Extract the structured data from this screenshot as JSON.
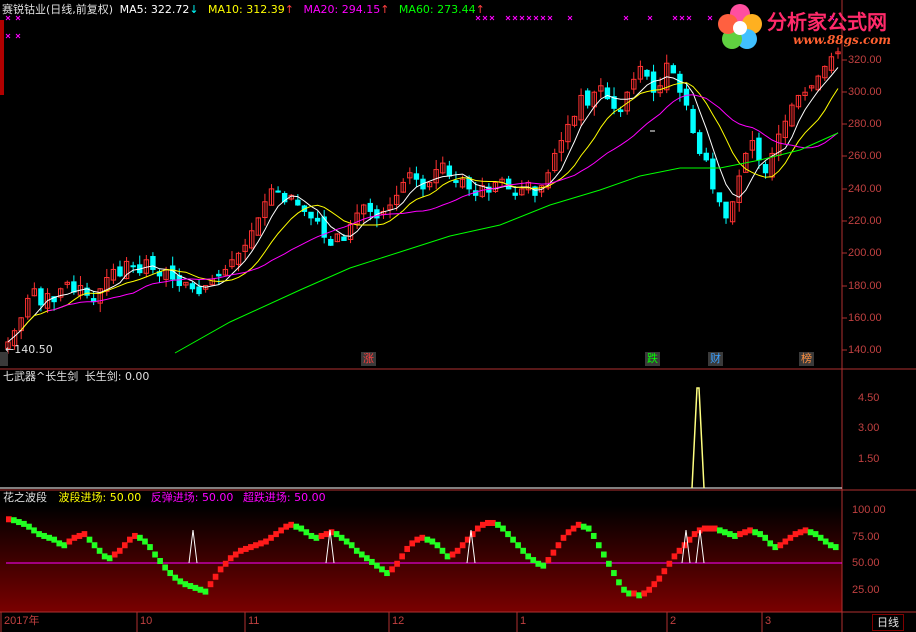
{
  "header": {
    "title": "赛锐钴业(日线,前复权)",
    "ma5_label": "MA5:",
    "ma5_value": "322.72",
    "ma10_label": "MA10:",
    "ma10_value": "312.39",
    "ma20_label": "MA20:",
    "ma20_value": "294.15",
    "ma60_label": "MA60:",
    "ma60_value": "273.44",
    "arrow_down": "↓",
    "arrow_up": "↑"
  },
  "colors": {
    "ma5": "#ffffff",
    "ma10": "#ffff00",
    "ma20": "#ff00ff",
    "ma60": "#00ff00",
    "up": "#ff3232",
    "down": "#00ffff",
    "axis": "#b03030",
    "grid": "#700000"
  },
  "watermark": {
    "text": "分析家公式网",
    "url": "www.88gs.com"
  },
  "main_panel": {
    "y_axis_ticks": [
      "320.00",
      "300.00",
      "280.00",
      "260.00",
      "240.00",
      "220.00",
      "200.00",
      "180.00",
      "160.00",
      "140.00"
    ],
    "low_marker": "←140.50",
    "event_badges": [
      {
        "text": "涨",
        "color": "#ff4040"
      },
      {
        "text": "跌",
        "color": "#00ff00"
      },
      {
        "text": "财",
        "color": "#3aa0ff"
      },
      {
        "text": "榜",
        "color": "#ff9040"
      }
    ]
  },
  "mid_panel": {
    "title": "七武器^长生剑",
    "indicator_label": "长生剑:",
    "indicator_value": "0.00",
    "y_axis_ticks": [
      "4.50",
      "3.00",
      "1.50"
    ]
  },
  "bottom_panel": {
    "title": "花之波段",
    "wave_label": "波段进场:",
    "wave_value": "50.00",
    "rebound_label": "反弹进场:",
    "rebound_value": "50.00",
    "oversold_label": "超跌进场:",
    "oversold_value": "50.00",
    "y_axis_ticks": [
      "100.00",
      "75.00",
      "50.00",
      "25.00"
    ]
  },
  "x_axis": {
    "labels": [
      "2017年",
      "10",
      "11",
      "12",
      "1",
      "2",
      "3"
    ],
    "period_button": "日线"
  }
}
